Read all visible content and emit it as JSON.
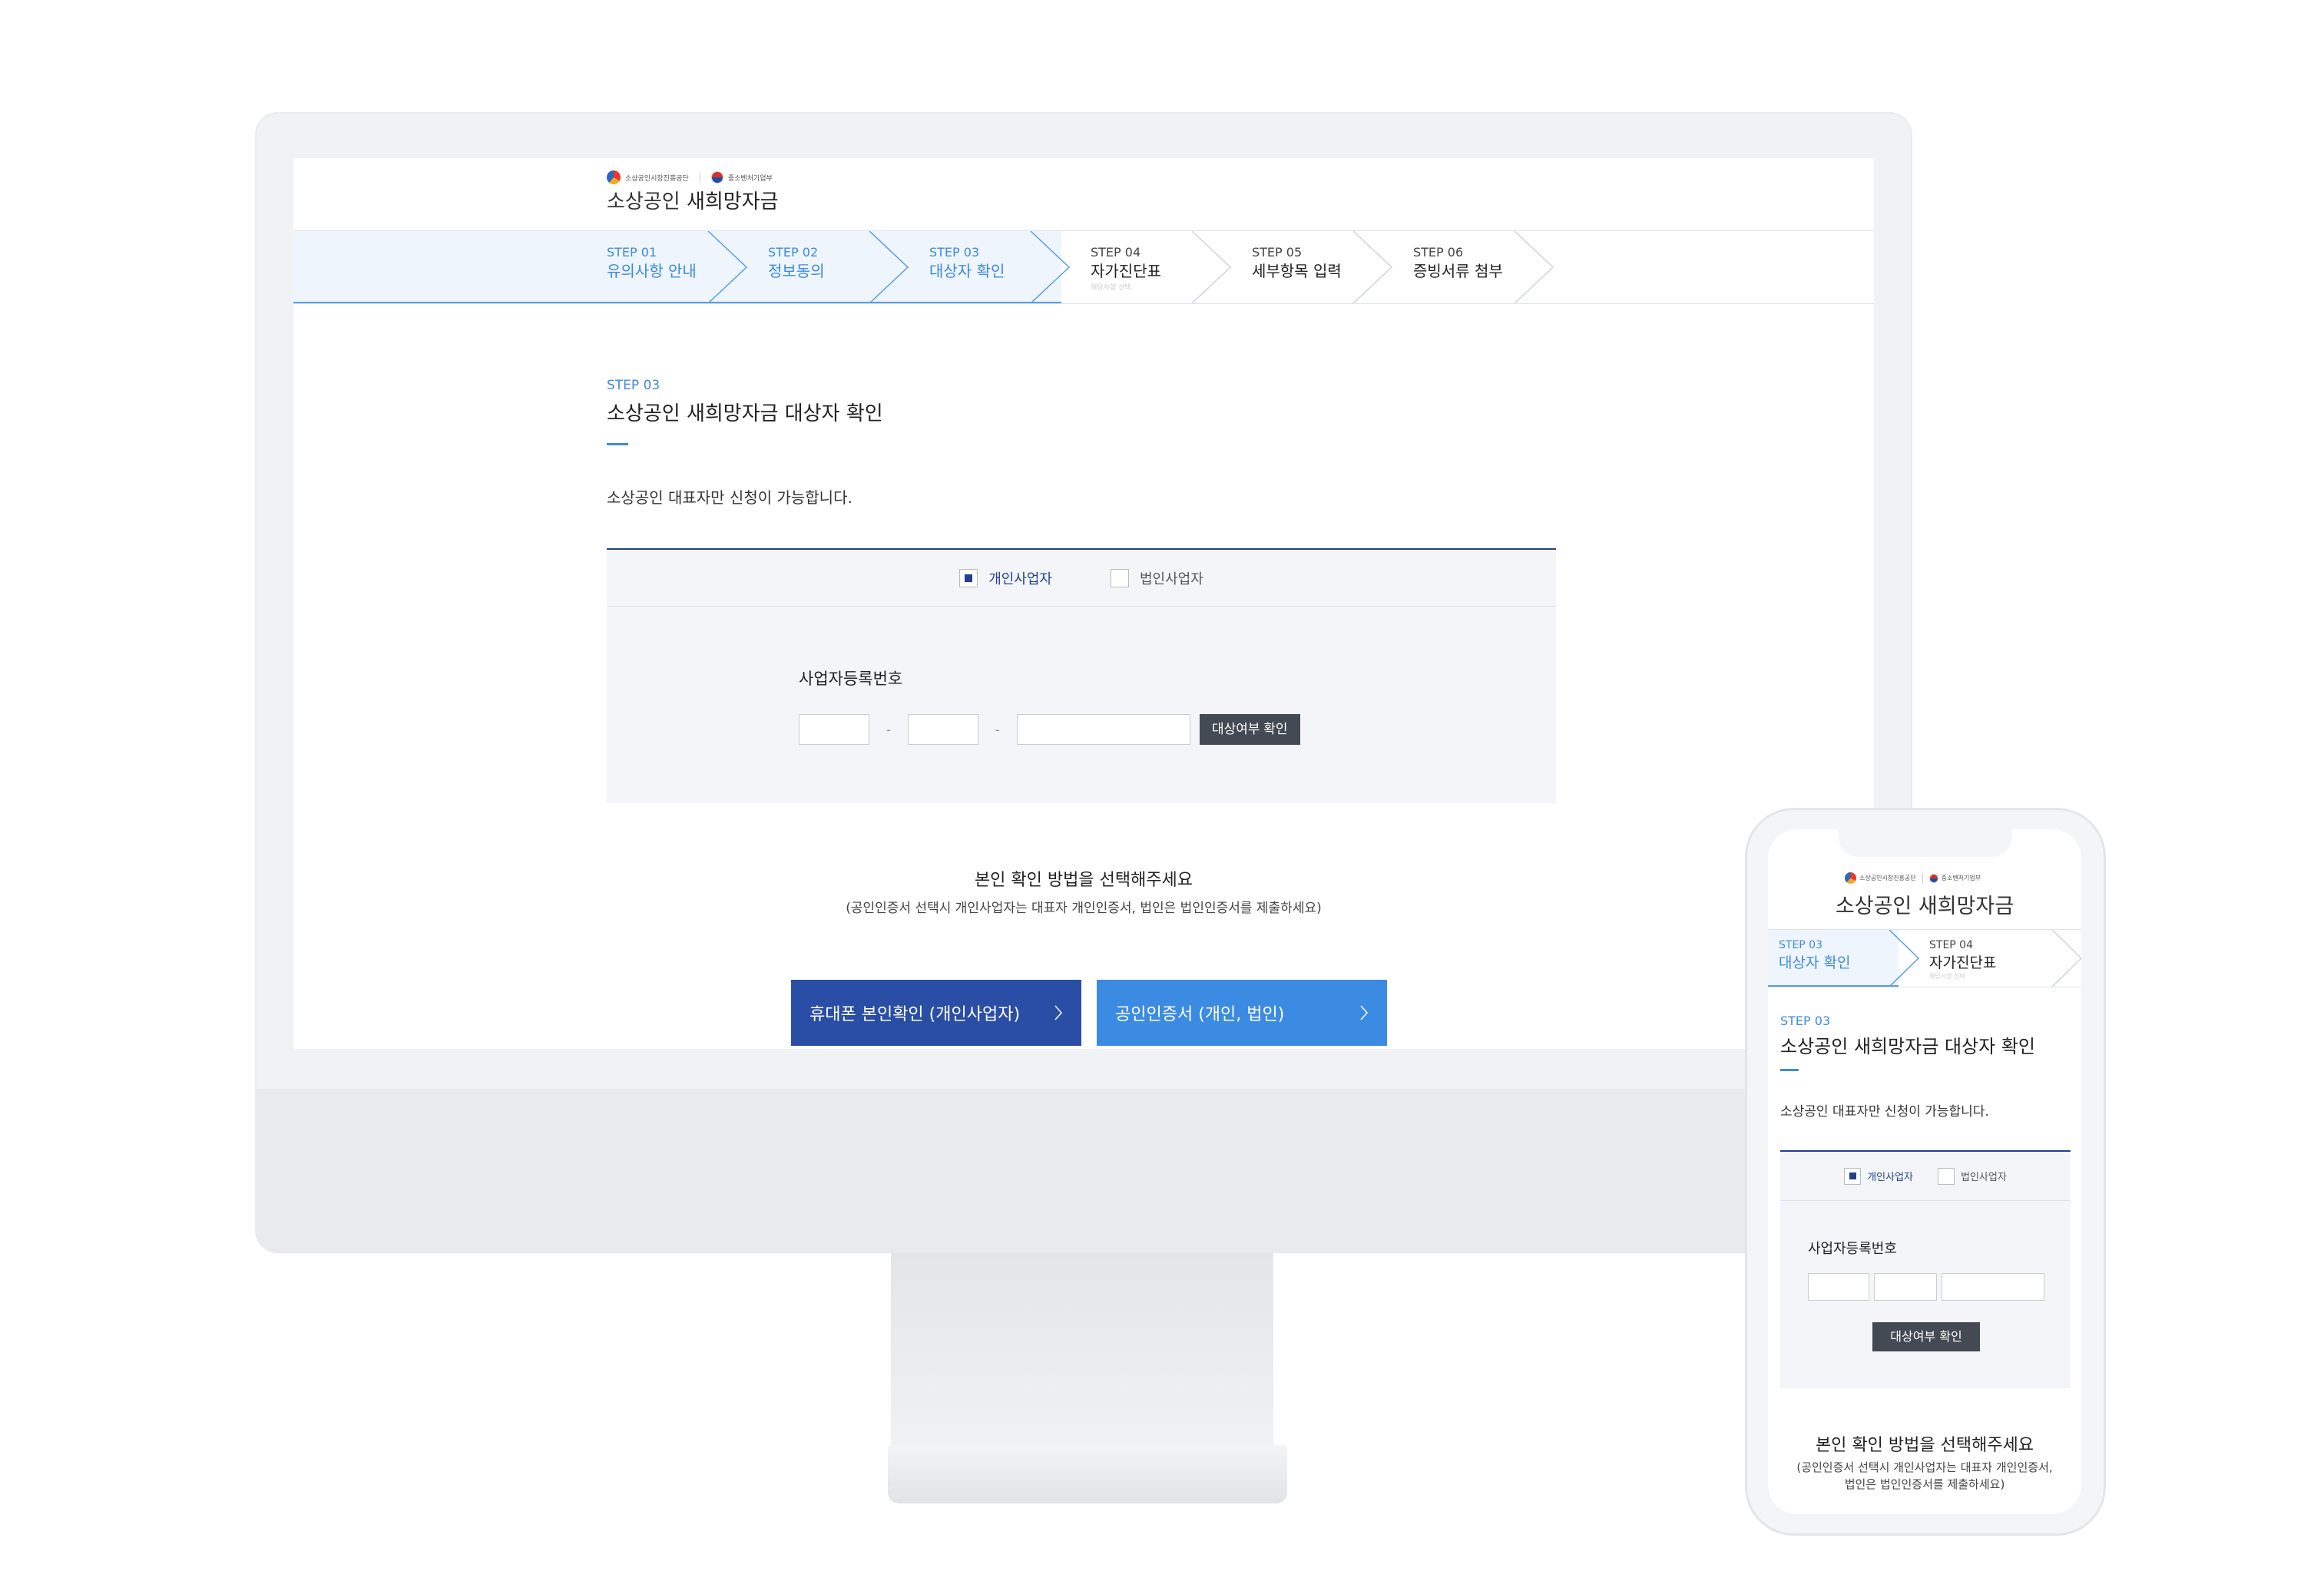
{
  "org": {
    "agency": "소상공인시장진흥공단",
    "ministry": "중소벤처기업부"
  },
  "site": {
    "title_part1": "소상공인",
    "title_part2": "새희망자금"
  },
  "steps": [
    {
      "num": "STEP 01",
      "name": "유의사항 안내",
      "status": "done"
    },
    {
      "num": "STEP 02",
      "name": "정보동의",
      "status": "done"
    },
    {
      "num": "STEP 03",
      "name": "대상자 확인",
      "status": "current"
    },
    {
      "num": "STEP 04",
      "name": "자가진단표",
      "sub": "해당사항 선택",
      "status": "todo"
    },
    {
      "num": "STEP 05",
      "name": "세부항목 입력",
      "status": "todo"
    },
    {
      "num": "STEP 06",
      "name": "증빙서류 첨부",
      "status": "todo"
    }
  ],
  "section": {
    "step": "STEP 03",
    "title": "소상공인 새희망자금 대상자 확인",
    "description": "소상공인 대표자만 신청이 가능합니다."
  },
  "business_type": {
    "options": [
      "개인사업자",
      "법인사업자"
    ],
    "selected": "개인사업자"
  },
  "registration": {
    "label": "사업자등록번호",
    "part1": "",
    "part2": "",
    "part3": "",
    "dash": "-",
    "check_button": "대상여부 확인"
  },
  "auth": {
    "title": "본인 확인 방법을 선택해주세요",
    "note": "(공인인증서 선택시 개인사업자는 대표자 개인인증서, 법인은 법인인증서를 제출하세요)",
    "mobile_note_line1": "(공인인증서 선택시 개인사업자는 대표자 개인인증서,",
    "mobile_note_line2": "법인은 법인인증서를 제출하세요)",
    "phone_button": "휴대폰 본인확인 (개인사업자)",
    "cert_button": "공인인증서 (개인, 법인)"
  },
  "colors": {
    "accent_blue": "#3d8ae0",
    "navy": "#243f8f",
    "phone_button": "#2a4ea5",
    "cert_button": "#3b8be3",
    "dark_button": "#444a53"
  }
}
